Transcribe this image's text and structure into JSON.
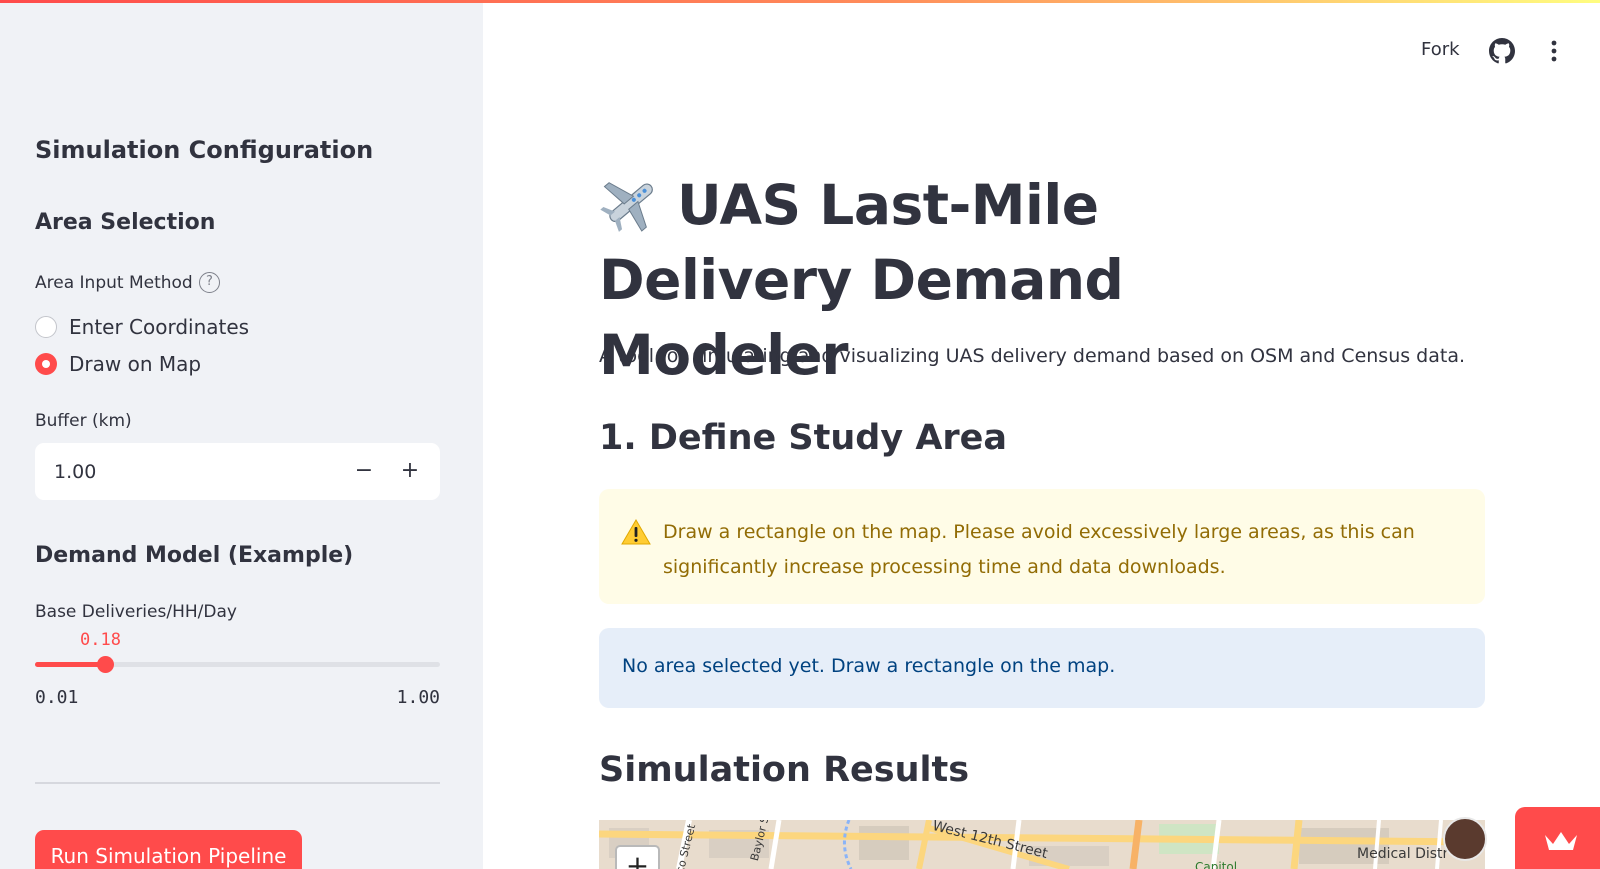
{
  "header": {
    "fork_label": "Fork",
    "github_icon": "github-icon",
    "menu_icon": "kebab-menu-icon"
  },
  "sidebar": {
    "title": "Simulation Configuration",
    "area_section_title": "Area Selection",
    "area_input_label": "Area Input Method",
    "area_options": [
      {
        "label": "Enter Coordinates",
        "selected": false
      },
      {
        "label": "Draw on Map",
        "selected": true
      }
    ],
    "buffer_label": "Buffer (km)",
    "buffer_value": "1.00",
    "minus_symbol": "−",
    "plus_symbol": "+",
    "demand_section_title": "Demand Model (Example)",
    "base_label": "Base Deliveries/HH/Day",
    "slider": {
      "value": "0.18",
      "min": "0.01",
      "max": "1.00"
    },
    "run_button": "Run Simulation Pipeline"
  },
  "main": {
    "title": "UAS Last-Mile Delivery Demand Modeler",
    "title_icon": "airplane-icon",
    "subtitle": "A tool for simulating and visualizing UAS delivery demand based on OSM and Census data.",
    "section1_title": "1. Define Study Area",
    "warning_text": "Draw a rectangle on the map. Please avoid excessively large areas, as this can significantly increase processing time and data downloads.",
    "info_text": "No area selected yet. Draw a rectangle on the map.",
    "results_title": "Simulation Results"
  },
  "map": {
    "zoom_in": "+",
    "labels": {
      "street_1": "West 12th Street",
      "street_2": "Baylor S",
      "street_3": "co Street",
      "district": "Medical Distr",
      "capitol": "Capitol"
    }
  },
  "colors": {
    "accent": "#ff4b4b",
    "sidebar_bg": "#f0f2f6",
    "warning_bg": "#fffce7",
    "warning_text": "#926c05",
    "info_bg": "#e6eef9",
    "info_text": "#004280"
  }
}
